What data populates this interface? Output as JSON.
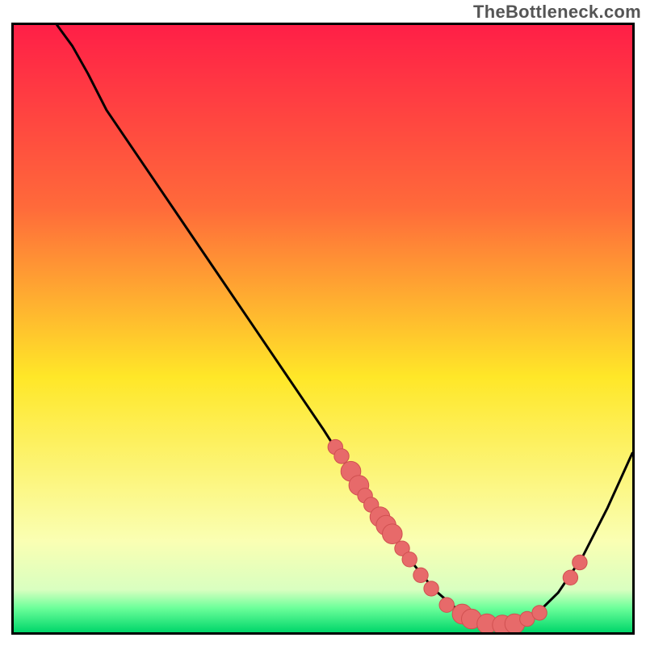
{
  "attribution": "TheBottleneck.com",
  "colors": {
    "gradient_top": "#ff1f47",
    "gradient_mid_upper": "#ff6a3a",
    "gradient_mid": "#ffe728",
    "gradient_lower": "#faffb3",
    "gradient_near_bottom": "#6cff9a",
    "gradient_bottom": "#00d66a",
    "curve": "#000000",
    "marker_fill": "#e76a6a",
    "marker_stroke": "#d05050"
  },
  "chart_data": {
    "type": "line",
    "title": "",
    "xlabel": "",
    "ylabel": "",
    "xlim": [
      0,
      100
    ],
    "ylim": [
      0,
      100
    ],
    "grid": false,
    "curve": [
      {
        "x": 7.0,
        "y": 100.0
      },
      {
        "x": 9.5,
        "y": 96.5
      },
      {
        "x": 12.0,
        "y": 92.0
      },
      {
        "x": 15.0,
        "y": 86.0
      },
      {
        "x": 20.0,
        "y": 78.5
      },
      {
        "x": 26.0,
        "y": 69.5
      },
      {
        "x": 32.0,
        "y": 60.5
      },
      {
        "x": 38.0,
        "y": 51.5
      },
      {
        "x": 44.0,
        "y": 42.5
      },
      {
        "x": 50.0,
        "y": 33.5
      },
      {
        "x": 55.0,
        "y": 25.5
      },
      {
        "x": 60.0,
        "y": 18.0
      },
      {
        "x": 64.0,
        "y": 12.0
      },
      {
        "x": 68.0,
        "y": 7.0
      },
      {
        "x": 72.0,
        "y": 3.5
      },
      {
        "x": 76.0,
        "y": 1.5
      },
      {
        "x": 80.0,
        "y": 1.2
      },
      {
        "x": 84.0,
        "y": 2.5
      },
      {
        "x": 88.0,
        "y": 6.5
      },
      {
        "x": 92.0,
        "y": 12.5
      },
      {
        "x": 96.0,
        "y": 20.5
      },
      {
        "x": 100.0,
        "y": 29.5
      }
    ],
    "markers": [
      {
        "x": 52.0,
        "y": 30.5,
        "r": 1.2
      },
      {
        "x": 53.0,
        "y": 29.0,
        "r": 1.2
      },
      {
        "x": 54.5,
        "y": 26.5,
        "r": 1.6
      },
      {
        "x": 55.8,
        "y": 24.2,
        "r": 1.6
      },
      {
        "x": 56.8,
        "y": 22.5,
        "r": 1.2
      },
      {
        "x": 57.8,
        "y": 21.0,
        "r": 1.2
      },
      {
        "x": 59.2,
        "y": 19.0,
        "r": 1.6
      },
      {
        "x": 60.2,
        "y": 17.6,
        "r": 1.6
      },
      {
        "x": 61.2,
        "y": 16.2,
        "r": 1.6
      },
      {
        "x": 62.8,
        "y": 13.8,
        "r": 1.2
      },
      {
        "x": 64.0,
        "y": 12.0,
        "r": 1.2
      },
      {
        "x": 65.8,
        "y": 9.4,
        "r": 1.2
      },
      {
        "x": 67.5,
        "y": 7.2,
        "r": 1.2
      },
      {
        "x": 70.0,
        "y": 4.5,
        "r": 1.2
      },
      {
        "x": 72.5,
        "y": 3.0,
        "r": 1.6
      },
      {
        "x": 74.0,
        "y": 2.2,
        "r": 1.6
      },
      {
        "x": 76.5,
        "y": 1.4,
        "r": 1.6
      },
      {
        "x": 79.0,
        "y": 1.2,
        "r": 1.6
      },
      {
        "x": 81.0,
        "y": 1.4,
        "r": 1.6
      },
      {
        "x": 83.0,
        "y": 2.2,
        "r": 1.2
      },
      {
        "x": 85.0,
        "y": 3.2,
        "r": 1.2
      },
      {
        "x": 90.0,
        "y": 9.0,
        "r": 1.2
      },
      {
        "x": 91.5,
        "y": 11.5,
        "r": 1.2
      }
    ],
    "gradient_bands": [
      {
        "y0": 100,
        "y1": 70,
        "c": "#ff1f47"
      },
      {
        "y0": 70,
        "y1": 40,
        "c": "#ff7a3a"
      },
      {
        "y0": 40,
        "y1": 15,
        "c": "#ffe728"
      },
      {
        "y0": 15,
        "y1": 5,
        "c": "#f7ffb0"
      },
      {
        "y0": 5,
        "y1": 0,
        "c": "#00d66a"
      }
    ]
  }
}
